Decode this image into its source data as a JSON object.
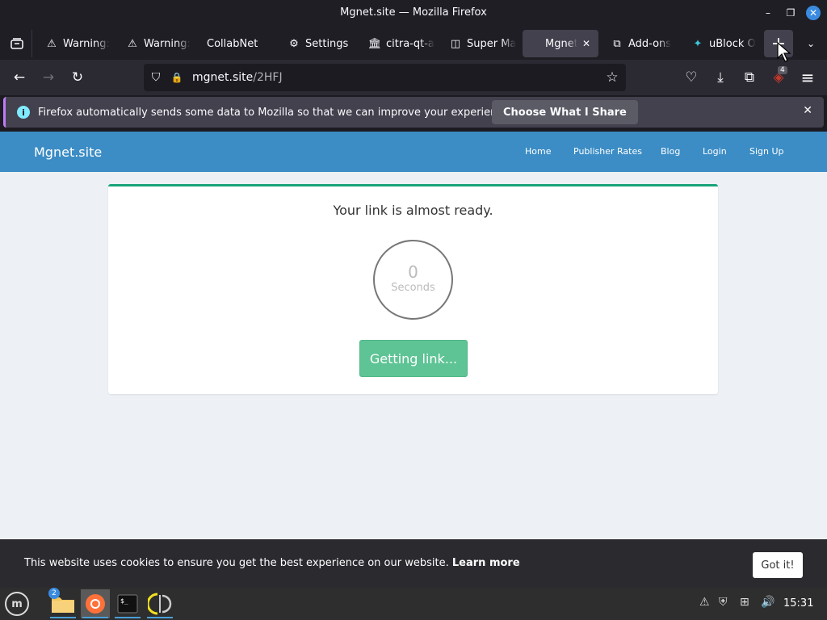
{
  "window": {
    "title": "Mgnet.site — Mozilla Firefox",
    "minimize_glyph": "–",
    "maximize_glyph": "❐",
    "close_glyph": "✕"
  },
  "tabs": [
    {
      "label": "Warning:",
      "icon": "warning-icon",
      "glyph": "⚠"
    },
    {
      "label": "Warning:",
      "icon": "warning-icon",
      "glyph": "⚠"
    },
    {
      "label": "CollabNet",
      "icon": "none",
      "glyph": ""
    },
    {
      "label": "Settings",
      "icon": "gear-icon",
      "glyph": "⚙"
    },
    {
      "label": "citra-qt-a",
      "icon": "bank-icon",
      "glyph": "🏛"
    },
    {
      "label": "Super Ma",
      "icon": "book-icon",
      "glyph": "◫"
    },
    {
      "label": "Mgnet.",
      "icon": "none",
      "glyph": "",
      "active": true
    },
    {
      "label": "Add-ons",
      "icon": "puzzle-icon",
      "glyph": "⧉"
    },
    {
      "label": "uBlock O",
      "icon": "ublock-icon",
      "glyph": "✦"
    }
  ],
  "tab_close_glyph": "✕",
  "new_tab_glyph": "+",
  "tab_overflow_glyph": "⌄",
  "navbar": {
    "back_glyph": "←",
    "forward_glyph": "→",
    "reload_glyph": "↻",
    "url_domain": "mgnet.site",
    "url_path": "/2HFJ",
    "shield_glyph": "⛉",
    "lock_glyph": "🔒",
    "star_glyph": "☆",
    "pocket_glyph": "♡",
    "download_glyph": "⤓",
    "extensions_glyph": "⧉",
    "ublock_glyph": "◈",
    "ublock_count": "4",
    "menu_glyph": "≡"
  },
  "notification": {
    "text": "Firefox automatically sends some data to Mozilla so that we can improve your experience.",
    "button_label": "Choose What I Share",
    "info_glyph": "i",
    "close_glyph": "✕"
  },
  "site": {
    "brand": "Mgnet.site",
    "nav": [
      "Home",
      "Publisher Rates",
      "Blog",
      "Login",
      "Sign Up"
    ],
    "heading": "Your link is almost ready.",
    "timer_value": "0",
    "timer_unit": "Seconds",
    "button_label": "Getting link..."
  },
  "cookie": {
    "text": "This website uses cookies to ensure you get the best experience on our website.",
    "learn_more": "Learn more",
    "button": "Got it!"
  },
  "taskbar": {
    "menu_glyph": "m",
    "files_badge": "2",
    "clock": "15:31"
  },
  "colors": {
    "site_nav": "#3c8dc5",
    "card_accent": "#1aa37a",
    "button_green": "#5ec495"
  }
}
